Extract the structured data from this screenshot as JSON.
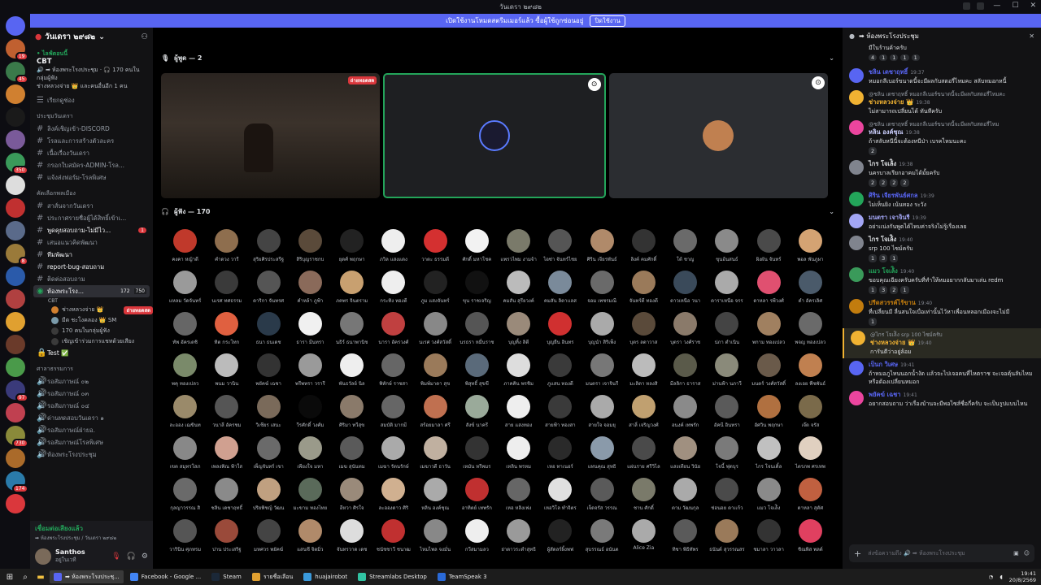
{
  "window": {
    "title": "วันเดรา ๒๙๘๒"
  },
  "banner": {
    "text": "เปิดใช้งานโหมดสตรีมเมอร์แล้ว ซื้อผู้ใช้ถูกซ่อนอยู่",
    "button": "ปิดใช้งาน"
  },
  "server": {
    "name": "วันเดรา ๒๙๘๒"
  },
  "event": {
    "live": "• ไลฟ์ตอนนี้",
    "name": "CBT",
    "detail1": "🔊 ➡ ห้องพระโรงประชุม · 🎧 170 คนในกลุ่มผู้ฟัง",
    "detail2": "ช่างหลวงจ่าย 👑 และคนอื่นอีก 1 คน"
  },
  "channel_top": "เรียกดูช่อง",
  "cat1": "ประชุมวันเดรา",
  "channels1": [
    "ลิงค์เชิญเข้า-DISCORD",
    "โรลและการสร้างตัวละคร",
    "เนื้อเรื่องวันเดรา",
    "กรอกใบสมัคร-ADMIN-โรล...",
    "แจ้งส่งฟอร์ม-โรลพิเศษ"
  ],
  "cat2": "คัดเลือกพลเมือง",
  "channels2": [
    "สาส์นจากวันเดรา",
    "ประกาศรายชื่อผู้ได้สิทธิ์เข้าเ...",
    "พูดคุยสอบถาม-ไม่มีไว...",
    "เสนอแนวคิดพัฒนา",
    "ทีมพัฒนา",
    "report-bug-สอบถาม",
    "ติดต่อสอบถาม"
  ],
  "unread_count": "1",
  "active_channel": {
    "name": "ห้องพระโรง...",
    "count1": "172",
    "count2": "750",
    "sub": "CBT"
  },
  "voice_users": [
    {
      "name": "ช่างหลวงจ่าย 👑",
      "badge": "ถ่ายทอดสด"
    },
    {
      "name": "มีด ชะโงคลอง 👑 SM",
      "badge": ""
    },
    {
      "name": "170 คนในกลุ่มผู้ฟัง",
      "badge": ""
    },
    {
      "name": "เชิญเข้าร่วมการแชทด้วยเสียง",
      "badge": ""
    }
  ],
  "test_channel": "Test ✅",
  "cat3": "ศาลาธรรมการ",
  "channels3": [
    "รอสัมภาษณ์ ๐๒",
    "รอสัมภาษณ์ ๐๓",
    "รอสัมภาษณ์ ๐๔",
    "ด่านทดสอบวันเดรา ๑",
    "รอสัมภาษณ์ฝ่ายอ.",
    "รอสัมภาษณ์โรลพิเศษ",
    "ห้องพระโรงประชุม"
  ],
  "voice_status": {
    "connected": "เชื่อมต่อเสียงแล้ว",
    "where": "➡ ห้องพระโรงประชุม / วันเดรา ๒๙๘๒"
  },
  "user": {
    "name": "Santhos",
    "status": "อยู่ในเวที"
  },
  "speakers_header": "ผู้พูด — 2",
  "listeners_header": "ผู้ฟัง — 170",
  "live_label": "ถ่ายทอดสด",
  "listeners": [
    {
      "n": "คงคา หญ้าดี",
      "c": "#c0392b"
    },
    {
      "n": "คำดวง วารี",
      "c": "#8e6e4e"
    },
    {
      "n": "สุริยศิรประสรีฐ",
      "c": "#444"
    },
    {
      "n": "สิริบุญราชกบ",
      "c": "#5a4a3a"
    },
    {
      "n": "ยุดศ์ พฤกษา",
      "c": "#222"
    },
    {
      "n": "ภวิล แสงแดง",
      "c": "#eee"
    },
    {
      "n": "วาตะ ธรรมดี",
      "c": "#d43030"
    },
    {
      "n": "ศักดิ์ มหาโชค",
      "c": "#f2f2f2"
    },
    {
      "n": "แพรวไพม งามจ้า",
      "c": "#7a7a6a"
    },
    {
      "n": "ไอซ่า จันทร์ไชย",
      "c": "#555"
    },
    {
      "n": "ศิริน เจียรพันธ์",
      "c": "#b08a6a"
    },
    {
      "n": "ลิงค์ คมศักดิ์",
      "c": "#333"
    },
    {
      "n": "โต้ ชาญ",
      "c": "#6a6a6a"
    },
    {
      "n": "ขุนอ้นสนธ์",
      "c": "#8a8a8a"
    },
    {
      "n": "ผิงผัน จันทร์",
      "c": "#4a4a4a"
    },
    {
      "n": "พอล พันภูผา",
      "c": "#d4a373"
    },
    {
      "n": "แหลม วัดจันทร์",
      "c": "#9a9a9a"
    },
    {
      "n": "นเรศ ทศธรรม",
      "c": "#3a3a3a"
    },
    {
      "n": "ดาริกา จันทรศ",
      "c": "#555"
    },
    {
      "n": "คำหล้า ภูฟ้า",
      "c": "#8a6a5a"
    },
    {
      "n": "ภคพร จินตราม",
      "c": "#c8a070"
    },
    {
      "n": "กระทิง ทองดี",
      "c": "#eee"
    },
    {
      "n": "ภูม แสงจันทร์",
      "c": "#222"
    },
    {
      "n": "ขุน ราชเจริญ",
      "c": "#111"
    },
    {
      "n": "คมสัน สุรียวงค์",
      "c": "#bbb"
    },
    {
      "n": "คมสัน ลิตาเเลส",
      "c": "#7a8a9a"
    },
    {
      "n": "จอม เพชรมณี",
      "c": "#6a6a6a"
    },
    {
      "n": "จันทร์ดี ทองดี",
      "c": "#9a7a5a"
    },
    {
      "n": "ดาวเหนือ วนา",
      "c": "#3a4a5a"
    },
    {
      "n": "ดาราเหนือ จรร",
      "c": "#aaa"
    },
    {
      "n": "ดาหลา รพีวงศ์",
      "c": "#e05070"
    },
    {
      "n": "ดำ อัครเลิศ",
      "c": "#4a5a6a"
    },
    {
      "n": "ทัพ อัครเดชิ",
      "c": "#666"
    },
    {
      "n": "ทิต กระโทก",
      "c": "#e06040"
    },
    {
      "n": "ธนา ธนเดช",
      "c": "#2a3a4a"
    },
    {
      "n": "ธารา มีนทรา",
      "c": "#f0f0f0"
    },
    {
      "n": "นธิร์ ธนาพานิช",
      "c": "#777"
    },
    {
      "n": "นารา อัครวงศ์",
      "c": "#c04040"
    },
    {
      "n": "นเรศ วงศ์สวัสดิ์",
      "c": "#888"
    },
    {
      "n": "นรธรา หมื่นราช",
      "c": "#555"
    },
    {
      "n": "บุญทิ้ง ลิตี",
      "c": "#9a8a7a"
    },
    {
      "n": "บุญยืน อินทร",
      "c": "#d03030"
    },
    {
      "n": "บุญนำ สิริเพ็ง",
      "c": "#aaa"
    },
    {
      "n": "บุตร ลดาวาส",
      "c": "#5a4a3a"
    },
    {
      "n": "บุตรา วงศ์ราช",
      "c": "#8a7a6a"
    },
    {
      "n": "ปภา ดำเนิน",
      "c": "#444"
    },
    {
      "n": "พกาม ทองเปลว",
      "c": "#a08060"
    },
    {
      "n": "พจญ ทองเปลว",
      "c": "#6a6a6a"
    },
    {
      "n": "พคุ ทองเปลว",
      "c": "#7a8a6a"
    },
    {
      "n": "พนม วานิน",
      "c": "#bbb"
    },
    {
      "n": "พยัคฆ์ เฉชา",
      "c": "#333"
    },
    {
      "n": "พรีพทรา วรารี",
      "c": "#9a9a9a"
    },
    {
      "n": "พันธวัลย์ นิล",
      "c": "#eee"
    },
    {
      "n": "พิทักษ์ ราชสา",
      "c": "#666"
    },
    {
      "n": "พิมพ์มาดา สุข",
      "c": "#9a7a5a"
    },
    {
      "n": "พิสุทธิ์ สุขขี",
      "c": "#5a6a7a"
    },
    {
      "n": "ภาคคิน พรชิม",
      "c": "#ddd"
    },
    {
      "n": "ภูแสน ทองดี",
      "c": "#3a3a3a"
    },
    {
      "n": "มนตรา เจาจินรี",
      "c": "#777"
    },
    {
      "n": "มะลิดา หลงสิ",
      "c": "#bbb"
    },
    {
      "n": "มีลลิกา ธาราส",
      "c": "#5a5a4a"
    },
    {
      "n": "ม่านฟ้า นภาวี",
      "c": "#8a8a7a"
    },
    {
      "n": "มนตร์ วงศ์สวัสดิ์",
      "c": "#6a5a4a"
    },
    {
      "n": "ลงเอย พืชพันธ์",
      "c": "#c08050"
    },
    {
      "n": "ละออง เฌขินท",
      "c": "#9a8a6a"
    },
    {
      "n": "วนาลี อัครชม",
      "c": "#555"
    },
    {
      "n": "วิเชียร เสนะ",
      "c": "#7a6a5a"
    },
    {
      "n": "วีรศักดิ์ วงศ์ม",
      "c": "#0a0a0a"
    },
    {
      "n": "ศิริมา ทวีสุข",
      "c": "#8a7a6a"
    },
    {
      "n": "สมบัติ มากมี",
      "c": "#666"
    },
    {
      "n": "สร้อยมาลา ศรี",
      "c": "#c07050"
    },
    {
      "n": "สังข์ นาครี",
      "c": "#9aaa9a"
    },
    {
      "n": "สาย แสงทอง",
      "c": "#eee"
    },
    {
      "n": "สายฟ้า ทองสา",
      "c": "#3a3a3a"
    },
    {
      "n": "สายใจ จอมยุ",
      "c": "#aaa"
    },
    {
      "n": "สาลี่ เจริญวงศ์",
      "c": "#c0a070"
    },
    {
      "n": "อนงค์ เทพรัก",
      "c": "#8a8a8a"
    },
    {
      "n": "อัคนี อินทรา",
      "c": "#5a5a5a"
    },
    {
      "n": "อัศวิน พฤกษา",
      "c": "#b07040"
    },
    {
      "n": "เจ๊ด จรัส",
      "c": "#7a6a4a"
    },
    {
      "n": "เขต สมุทรโสภ",
      "c": "#888"
    },
    {
      "n": "เพลงพิณ ฟ้าใส",
      "c": "#d0a090"
    },
    {
      "n": "เพ็ญจันทร์ เขา",
      "c": "#6a6a6a"
    },
    {
      "n": "เพียงใจ มหา",
      "c": "#9a9a8a"
    },
    {
      "n": "เมฆ สุนันทม",
      "c": "#5a5a5a"
    },
    {
      "n": "เมฆา รัตนรักษ์",
      "c": "#aaa"
    },
    {
      "n": "เมฆาวดี ธาวัน",
      "c": "#c0b0a0"
    },
    {
      "n": "เหมัน หรีพมร",
      "c": "#333"
    },
    {
      "n": "เหลิน พรหม",
      "c": "#eee"
    },
    {
      "n": "เหอ ทาเนอร์",
      "c": "#2a2a2a"
    },
    {
      "n": "แทนคุณ สุทธิ",
      "c": "#8a9aaa"
    },
    {
      "n": "แผ่นราย ศรีวิไล",
      "c": "#4a4a4a"
    },
    {
      "n": "แสงเทียน วินัย",
      "c": "#a09080"
    },
    {
      "n": "โจนี้ ฟุตบุร",
      "c": "#7a7a7a"
    },
    {
      "n": "ไกร โจนเติ้ล",
      "c": "#c0c0c0"
    },
    {
      "n": "ไตรภพ ศรเทพ",
      "c": "#e0d0c0"
    },
    {
      "n": "กุลญาวรรณ สิ",
      "c": "#6a6a6a"
    },
    {
      "n": "ชลิน เดชาฤทธิ์",
      "c": "#8a8a8a"
    },
    {
      "n": "ปริยพิชญ์ วัฒน",
      "c": "#c0a080"
    },
    {
      "n": "มะขาม ทองไทย",
      "c": "#5a6a5a"
    },
    {
      "n": "อีหวา ศิรใจ",
      "c": "#9a8a7a"
    },
    {
      "n": "ละอองดาว ศิริ",
      "c": "#d0b090"
    },
    {
      "n": "หลิน องค์ชุณ",
      "c": "#aaa"
    },
    {
      "n": "อาทิตย์ เทพรัก",
      "c": "#c03030"
    },
    {
      "n": "เหอ หลิงเฟง",
      "c": "#666"
    },
    {
      "n": "เหอวิโล ทำจิตร",
      "c": "#e0e0e0"
    },
    {
      "n": "เจ็ดจรัส วรรณ",
      "c": "#5a5a5a"
    },
    {
      "n": "ชาน ศักดิ์",
      "c": "#7a7a6a"
    },
    {
      "n": "ตาม วัฒนกุล",
      "c": "#aaa"
    },
    {
      "n": "ช่อนอย ดาเเก้ว",
      "c": "#4a4a4a"
    },
    {
      "n": "แมว โจเล้ิง",
      "c": "#8a8a8a"
    },
    {
      "n": "ดาหลา สุตัศ",
      "c": "#c06040"
    },
    {
      "n": "วารินิน ศุภทรม",
      "c": "#555"
    },
    {
      "n": "ปาน ประเสริฐ",
      "c": "#9a4a3a"
    },
    {
      "n": "มหศวร พยัคฆ์",
      "c": "#444"
    },
    {
      "n": "แสนซี จิตมิ่ว",
      "c": "#b08a6a"
    },
    {
      "n": "จันทรวาด เดช",
      "c": "#ddd"
    },
    {
      "n": "ชนัชชาวี ชนาฒ",
      "c": "#c03030"
    },
    {
      "n": "ไหมไพล จงมั่น",
      "c": "#888"
    },
    {
      "n": "กวีสมามลว",
      "c": "#eee"
    },
    {
      "n": "ย่าดาวระดำสุทธิ",
      "c": "#9a9a9a"
    },
    {
      "n": "ผู้สัดลร์ผิ้งพฟ",
      "c": "#222"
    },
    {
      "n": "สุบรรณธ์ อนันต",
      "c": "#7a7a7a"
    },
    {
      "n": "Alice Zia",
      "c": "#aaa"
    },
    {
      "n": "ทิชา พิธิทัพร",
      "c": "#5a5a5a"
    },
    {
      "n": "ธนันต์ สุวรรณสร",
      "c": "#9a7a5a"
    },
    {
      "n": "ชมาลา วาวลา",
      "c": "#333"
    },
    {
      "n": "ชิณพิส พลต์",
      "c": "#e04060"
    }
  ],
  "chat": {
    "title": "➡ ห้องพระโรงประชุม",
    "top_text": "มีในร้านค้าครับ",
    "top_rx": [
      "4",
      "1",
      "1",
      "1",
      "1"
    ],
    "messages": [
      {
        "author": "ชลิน เดชาฤทธิ์",
        "color": "#5865f2",
        "time": "19:37",
        "reply": "",
        "text": "หมอกลีเบอร์ขนาดนี้จะมีผลกับสตอรี่ไหมคะ สลับหมอกหนี้",
        "rx": []
      },
      {
        "author": "ช่างหลวงจ่าย 👑",
        "color": "#f0b232",
        "time": "19:38",
        "reply": "@ชลิน เดชาฤทธิ์ หมอกลีเบอร์ขนาดนี้จะมีผลกับสตอรี่ไหมคะ",
        "text": "ไม่สามารถเปลี่ยนได้ ทันทีครับ",
        "rx": []
      },
      {
        "author": "หลิน องค์ชุณ",
        "color": "#c9cdfb",
        "time": "19:38",
        "reply": "@ชลิน เดชาฤทธิ์ หมอกลีเบอร์ขนาดนี้จะมีผลกับสตอรี่ไหม",
        "text": "ถ้าสลับหนีนี้จะต้องหนีป่า เบรคไหมนะคะ",
        "rx": [
          "2"
        ]
      },
      {
        "author": "ไกร โจเล้ิง",
        "color": "#dbdee1",
        "time": "19:38",
        "reply": "",
        "text": "นครบาลเรียกอาคมได้มั้ยครับ",
        "rx": [
          "2",
          "2",
          "2",
          "2"
        ]
      },
      {
        "author": "ศิริน เจียรพันธ์ศกล",
        "color": "#5865f2",
        "time": "19:39",
        "reply": "",
        "text": "ไม่เห็นยิง เน้นทอง ระวัง",
        "rx": []
      },
      {
        "author": "มนตรา เจาจินรี",
        "color": "#a3a6f5",
        "time": "19:39",
        "reply": "",
        "text": "อย่าเเน่งกันพูดได้ไหมค่าจริงไม่รู้เรื่องเลย",
        "rx": []
      },
      {
        "author": "ไกร โจเล้ิง",
        "color": "#dbdee1",
        "time": "19:40",
        "reply": "",
        "text": "srp 100 ไซม์ครับ",
        "rx": [
          "1",
          "3",
          "1"
        ]
      },
      {
        "author": "แมว โจเล้ิง",
        "color": "#23a55a",
        "time": "19:40",
        "reply": "",
        "text": "ขอบคุณเฉียงครับครับที่ทำให้หมอยากกลับมาเล่น redm",
        "rx": [
          "1",
          "3",
          "2",
          "1"
        ]
      },
      {
        "author": "ปรีดสวรรค์ไร้ขาน",
        "color": "#c27c0e",
        "time": "19:40",
        "reply": "",
        "text": "ที่เปลี่ยนมี ลื่นสนใจเบื่อเท่านั้นไว้หาเพื่อนหลอกเมืองจะไม่มี",
        "rx": [
          "1"
        ]
      },
      {
        "author": "ช่างหลวงจ่าย 👑",
        "color": "#f0b232",
        "time": "19:40",
        "reply": "@ไกร โจเล้ิง srp 100 ไซม์ครับ",
        "text": "การันตีว่าอยู่ล้อม",
        "rx": []
      },
      {
        "author": "เป็นก วิเศษ",
        "color": "#5865f2",
        "time": "19:41",
        "reply": "",
        "text": "ถ้าหมอภูไหนนอกน้ำงัด แล้วจะไปเจอคนที่ไหตราช จะเจอคุ้นลับไหม หรือต้องเปลี่ยนหมอก",
        "rx": []
      },
      {
        "author": "พยัคฆ์ เฉชา",
        "color": "#5865f2",
        "time": "19:41",
        "reply": "",
        "text": "อยากสอบถาม ว่าเรื่องบ้านจะมีพอไซส์ชื่อกี่ครับ จะเป็นรูปแบบไหน",
        "rx": []
      }
    ],
    "input_placeholder": "ส่งข้อความถึง 🔊 ➡ ห้องพระโรงประชุม"
  },
  "taskbar": {
    "items": [
      "➡ ห้องพระโรงประชุ...",
      "Facebook - Google ...",
      "Steam",
      "รายชื่อเลือน",
      "huajairobot",
      "Streamlabs Desktop",
      "TeamSpeak 3"
    ],
    "time": "19:41",
    "date": "20/8/2569"
  }
}
